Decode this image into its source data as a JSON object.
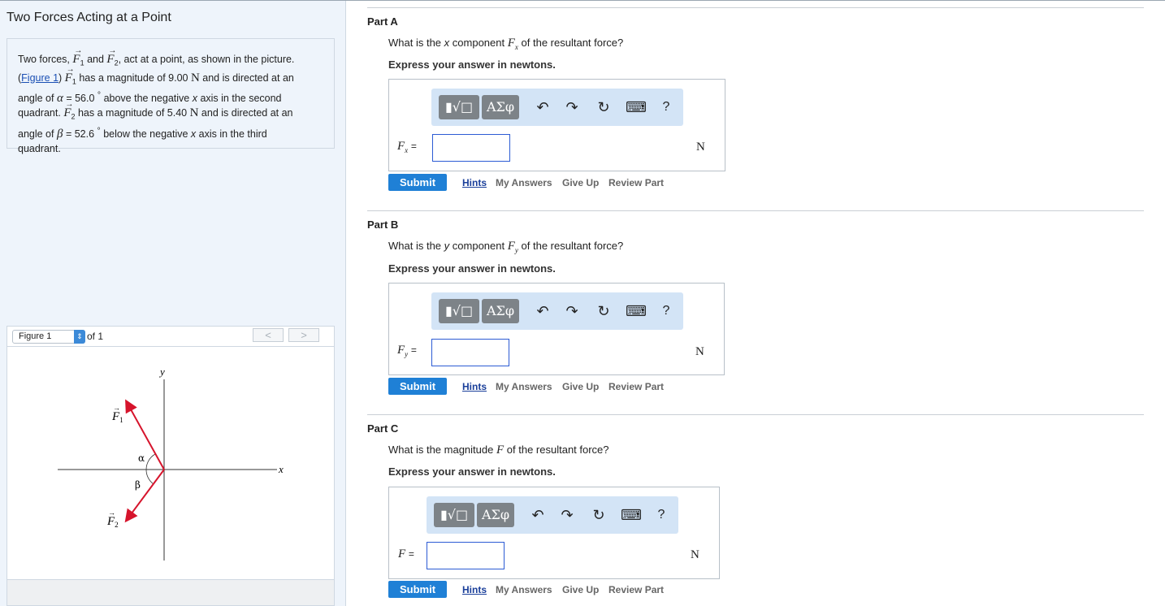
{
  "title": "Two Forces Acting at a Point",
  "problem": {
    "t1": "Two forces,",
    "f1": "F",
    "f1_sub": "1",
    "t2": "and",
    "f2": "F",
    "f2_sub": "2",
    "t3": ", act at a point, as shown in the picture.",
    "figure_link": "Figure 1",
    "t4": "has a magnitude of 9.00",
    "unit_N": "N",
    "t5": "and is directed at an",
    "t6": "angle of",
    "alpha": "α",
    "alpha_val": "= 56.0",
    "deg": "°",
    "t7": "above the negative",
    "x_var": "x",
    "t8": "axis in the second",
    "t9": "quadrant.",
    "t10": "has a magnitude of 5.40",
    "t11": "and is directed at an",
    "beta": "β",
    "beta_val": "= 52.6",
    "t12": "below the negative",
    "t13": "axis in the third",
    "t14": "quadrant."
  },
  "figure": {
    "select": "Figure 1",
    "of": "of 1",
    "prev": "<",
    "next": ">",
    "y_label": "y",
    "x_label": "x",
    "alpha_label": "α",
    "beta_label": "β",
    "f1_label": "F",
    "f1_sub": "1",
    "f2_label": "F",
    "f2_sub": "2",
    "arrow_color": "#d6142c"
  },
  "toolbar": {
    "templates": "▮√□",
    "symbols": "ΑΣφ",
    "undo": "↶",
    "redo": "↷",
    "reset": "↻",
    "keyboard": "⌨",
    "help": "?"
  },
  "actions": {
    "submit": "Submit",
    "hints": "Hints",
    "my_answers": "My Answers",
    "give_up": "Give Up",
    "review": "Review Part"
  },
  "parts": [
    {
      "title": "Part A",
      "q1": "What is the",
      "qvar": "x",
      "q2": "component",
      "sym": "F",
      "sym_sub": "x",
      "q3": "of the resultant force?",
      "instr": "Express your answer in newtons.",
      "label": "F",
      "label_sub": "x",
      "eq": "=",
      "unit": "N"
    },
    {
      "title": "Part B",
      "q1": "What is the",
      "qvar": "y",
      "q2": "component",
      "sym": "F",
      "sym_sub": "y",
      "q3": "of the resultant force?",
      "instr": "Express your answer in newtons.",
      "label": "F",
      "label_sub": "y",
      "eq": "=",
      "unit": "N"
    },
    {
      "title": "Part C",
      "q1": "What is the magnitude",
      "sym": "F",
      "q3": "of the resultant force?",
      "instr": "Express your answer in newtons.",
      "label": "F",
      "eq": "=",
      "unit": "N"
    }
  ]
}
